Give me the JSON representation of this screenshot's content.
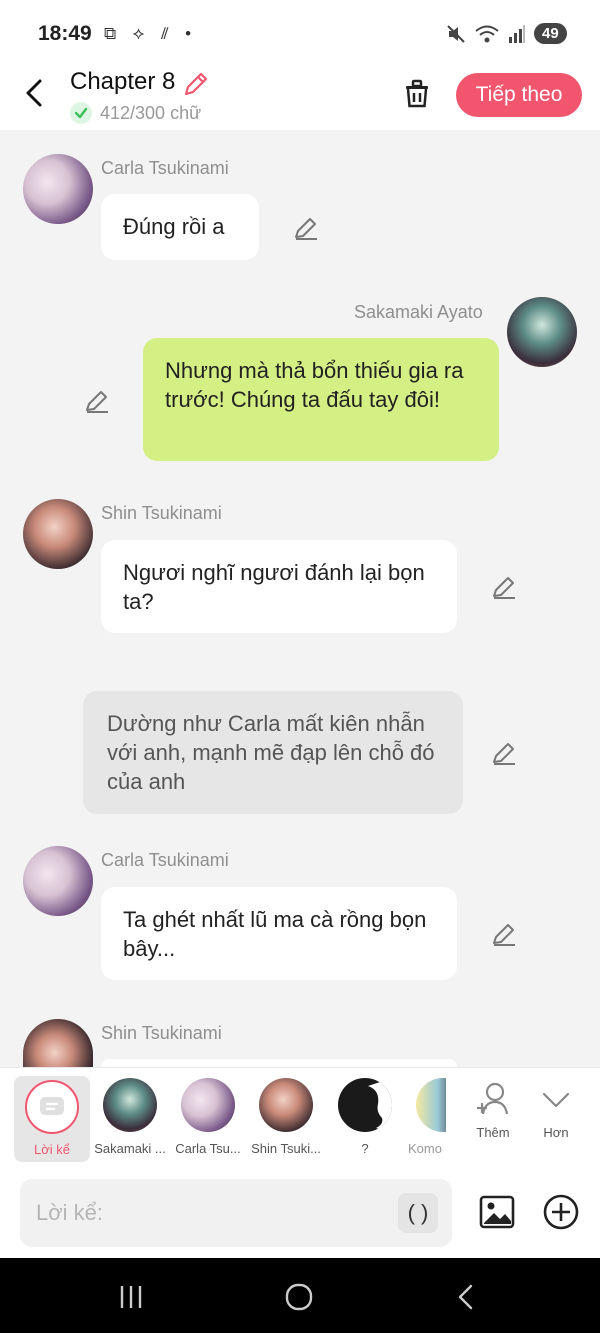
{
  "status_bar": {
    "time": "18:49",
    "battery": "49",
    "left_icons": "⧉ ⟡ ⫽ •",
    "network": "5"
  },
  "header": {
    "title": "Chapter 8",
    "word_count": "412/300 chữ",
    "next_label": "Tiếp theo"
  },
  "messages": [
    {
      "sender": "Carla Tsukinami",
      "text": "Đúng rồi a",
      "side": "left"
    },
    {
      "sender": "Sakamaki Ayato",
      "text": "Nhưng mà thả bổn thiếu gia ra trước! Chúng ta đấu tay đôi!",
      "side": "right"
    },
    {
      "sender": "Shin Tsukinami",
      "text": "Ngươi nghĩ ngươi đánh lại bọn ta?",
      "side": "left"
    },
    {
      "sender": "",
      "text": "Dường như Carla mất kiên nhẫn với anh, mạnh mẽ đạp lên chỗ đó của anh",
      "side": "narration"
    },
    {
      "sender": "Carla Tsukinami",
      "text": "Ta ghét nhất lũ ma cà rồng bọn bây...",
      "side": "left"
    },
    {
      "sender": "Shin Tsukinami",
      "text": "",
      "side": "left"
    }
  ],
  "character_bar": {
    "narration_label": "Lời kể",
    "characters": [
      "Sakamaki ...",
      "Carla Tsu...",
      "Shin Tsuki...",
      "?",
      "Komo"
    ],
    "more_label": "Thêm",
    "expand_label": "Hơn"
  },
  "input": {
    "placeholder": "Lời kể:",
    "paren_label": "( )"
  },
  "colors": {
    "accent": "#f2566f",
    "green_bubble": "#d4ef84",
    "check_green": "#3cbf5a"
  }
}
